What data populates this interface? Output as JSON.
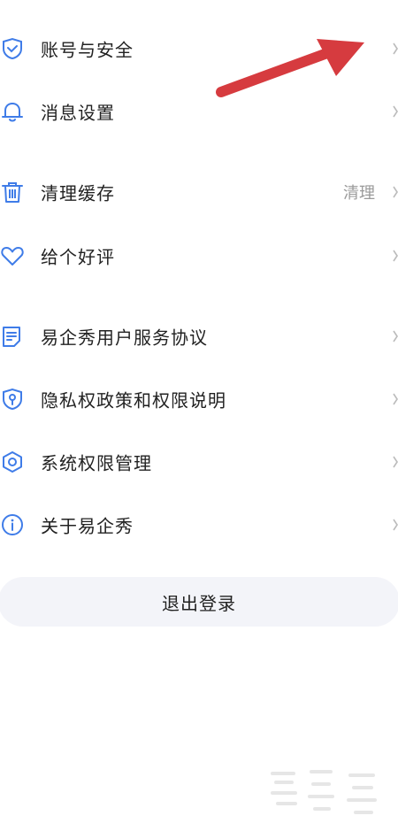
{
  "menu": {
    "items": [
      {
        "id": "account",
        "label": "账号与安全",
        "icon": "shield-check-icon",
        "value": ""
      },
      {
        "id": "notify",
        "label": "消息设置",
        "icon": "bell-icon",
        "value": ""
      },
      {
        "id": "cache",
        "label": "清理缓存",
        "icon": "trash-icon",
        "value": "清理"
      },
      {
        "id": "rate",
        "label": "给个好评",
        "icon": "heart-icon",
        "value": ""
      },
      {
        "id": "agreement",
        "label": "易企秀用户服务协议",
        "icon": "document-icon",
        "value": ""
      },
      {
        "id": "privacy",
        "label": "隐私权政策和权限说明",
        "icon": "shield-pin-icon",
        "value": ""
      },
      {
        "id": "permission",
        "label": "系统权限管理",
        "icon": "hexagon-gear-icon",
        "value": ""
      },
      {
        "id": "about",
        "label": "关于易企秀",
        "icon": "info-icon",
        "value": ""
      }
    ]
  },
  "logout": {
    "label": "退出登录"
  },
  "colors": {
    "icon": "#3f7ce8",
    "text": "#222222",
    "secondary": "#9a9a9a",
    "logout_bg": "#f3f4f9",
    "annotation_arrow": "#d63b3f"
  }
}
